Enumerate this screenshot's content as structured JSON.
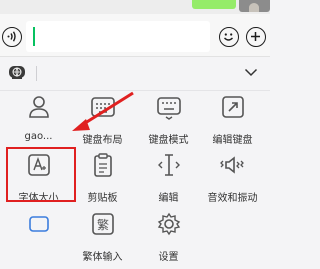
{
  "chat": {
    "input_value": ""
  },
  "icons": {
    "voice": "voice-icon",
    "emoji": "emoji-icon",
    "plus": "plus-icon",
    "globe": "keyboard-globe-icon",
    "collapse": "chevron-down-icon"
  },
  "grid": {
    "items": [
      {
        "label": "gao...",
        "icon": "user-icon"
      },
      {
        "label": "键盘布局",
        "icon": "keyboard-layout-icon"
      },
      {
        "label": "键盘模式",
        "icon": "keyboard-mode-icon"
      },
      {
        "label": "编辑键盘",
        "icon": "edit-keyboard-icon"
      },
      {
        "label": "字体大小",
        "icon": "font-size-icon"
      },
      {
        "label": "剪贴板",
        "icon": "clipboard-icon"
      },
      {
        "label": "编辑",
        "icon": "text-cursor-icon"
      },
      {
        "label": "音效和振动",
        "icon": "sound-vibration-icon"
      },
      {
        "label": "",
        "icon": "partial-icon"
      },
      {
        "label": "繁体输入",
        "icon": "traditional-chinese-icon"
      },
      {
        "label": "设置",
        "icon": "gear-icon"
      }
    ]
  },
  "colors": {
    "highlight": "#e02020",
    "caret": "#07c160",
    "bubble": "#95ec69"
  }
}
